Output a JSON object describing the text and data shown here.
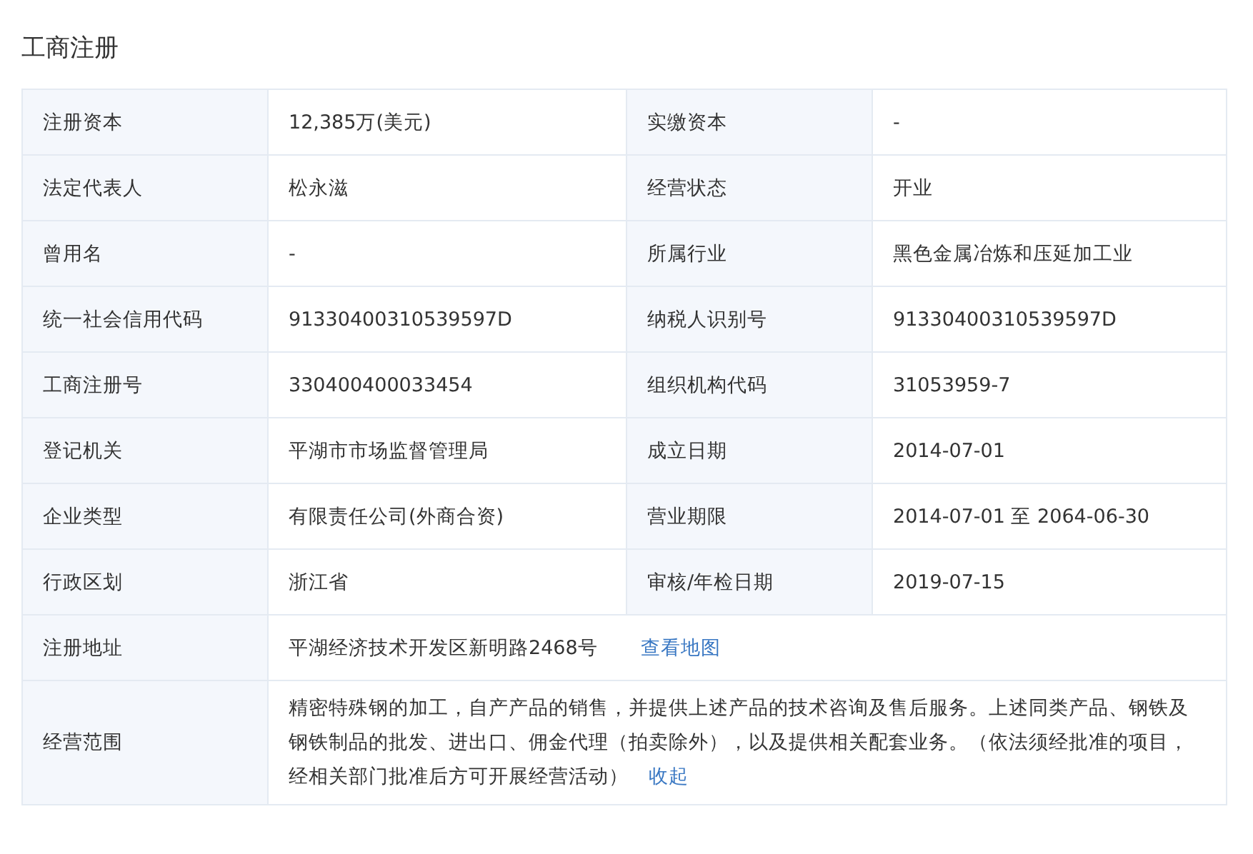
{
  "title": "工商注册",
  "rows": [
    {
      "fields": [
        {
          "label": "注册资本",
          "value": "12,385万(美元)"
        },
        {
          "label": "实缴资本",
          "value": "-"
        }
      ]
    },
    {
      "fields": [
        {
          "label": "法定代表人",
          "value": "松永滋"
        },
        {
          "label": "经营状态",
          "value": "开业"
        }
      ]
    },
    {
      "fields": [
        {
          "label": "曾用名",
          "value": "-"
        },
        {
          "label": "所属行业",
          "value": "黑色金属冶炼和压延加工业"
        }
      ]
    },
    {
      "fields": [
        {
          "label": "统一社会信用代码",
          "value": "91330400310539597D"
        },
        {
          "label": "纳税人识别号",
          "value": "91330400310539597D"
        }
      ]
    },
    {
      "fields": [
        {
          "label": "工商注册号",
          "value": "330400400033454"
        },
        {
          "label": "组织机构代码",
          "value": "31053959-7"
        }
      ]
    },
    {
      "fields": [
        {
          "label": "登记机关",
          "value": "平湖市市场监督管理局"
        },
        {
          "label": "成立日期",
          "value": "2014-07-01"
        }
      ]
    },
    {
      "fields": [
        {
          "label": "企业类型",
          "value": "有限责任公司(外商合资)"
        },
        {
          "label": "营业期限",
          "value": "2014-07-01 至 2064-06-30"
        }
      ]
    },
    {
      "fields": [
        {
          "label": "行政区划",
          "value": "浙江省"
        },
        {
          "label": "审核/年检日期",
          "value": "2019-07-15"
        }
      ]
    },
    {
      "fields": [
        {
          "label": "注册地址",
          "value": "平湖经济技术开发区新明路2468号",
          "link": "查看地图"
        }
      ]
    },
    {
      "fields": [
        {
          "label": "经营范围",
          "value": "精密特殊钢的加工，自产产品的销售，并提供上述产品的技术咨询及售后服务。上述同类产品、钢铁及钢铁制品的批发、进出口、佣金代理（拍卖除外），以及提供相关配套业务。（依法须经批准的项目，经相关部门批准后方可开展经营活动）",
          "link": "收起"
        }
      ]
    }
  ]
}
